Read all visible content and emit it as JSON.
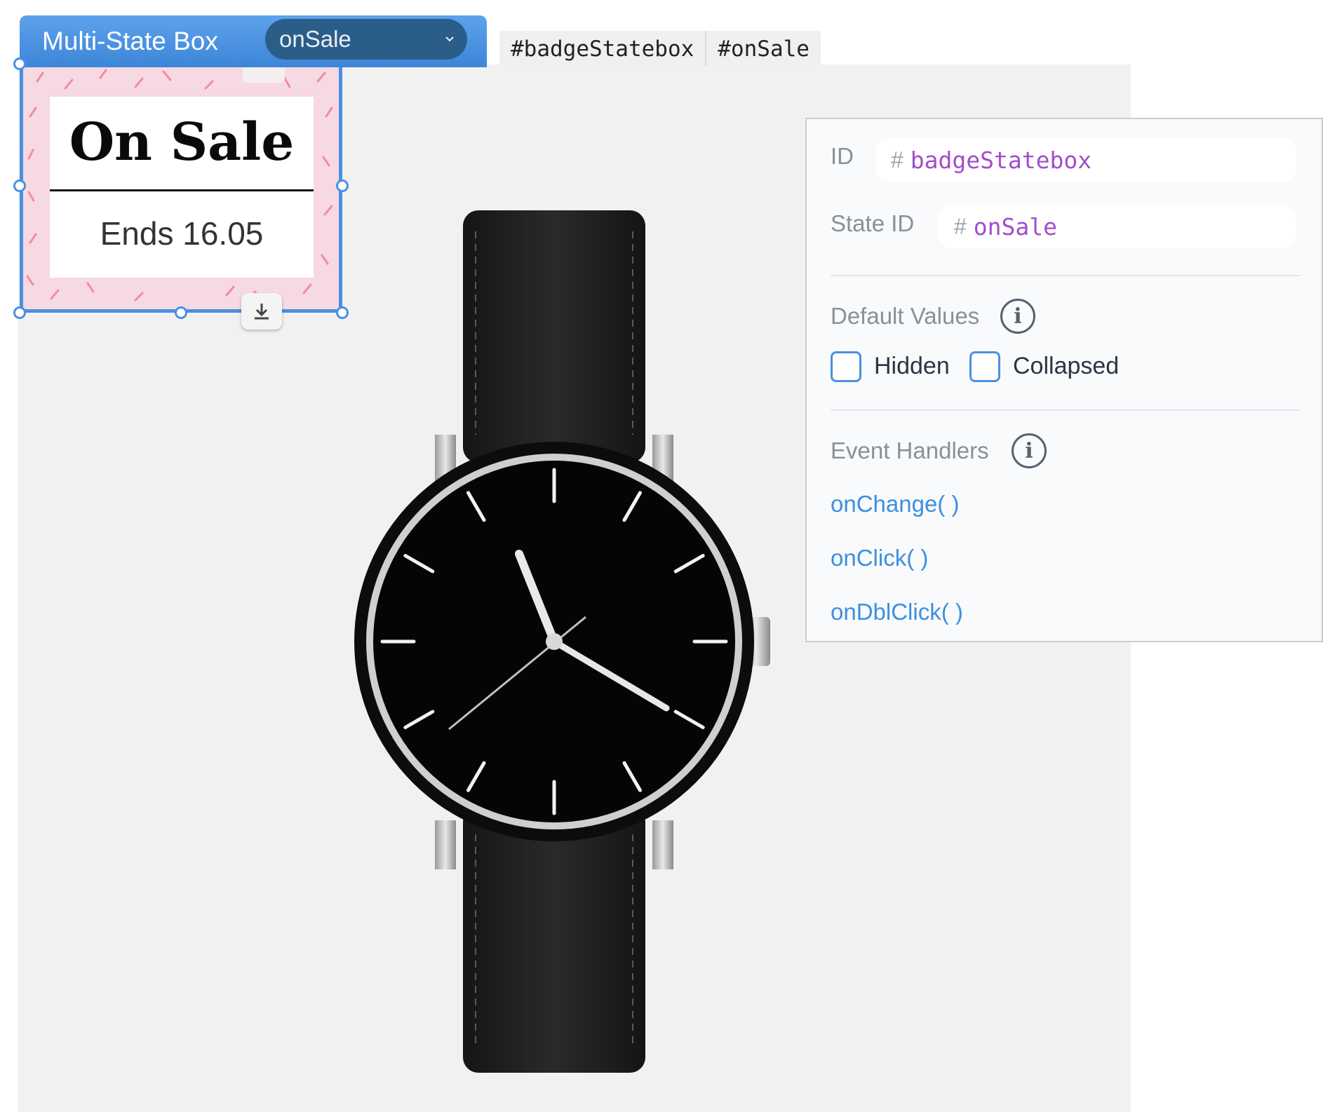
{
  "toolbar": {
    "title": "Multi-State Box",
    "state_selected": "onSale"
  },
  "id_tags": [
    "#badgeStatebox",
    "#onSale"
  ],
  "badge": {
    "title": "On Sale",
    "subtitle": "Ends 16.05"
  },
  "properties": {
    "id_label": "ID",
    "id_value": "badgeStatebox",
    "state_id_label": "State ID",
    "state_id_value": "onSale",
    "hash": "#",
    "default_values_label": "Default Values",
    "hidden_label": "Hidden",
    "collapsed_label": "Collapsed",
    "event_handlers_label": "Event Handlers",
    "handlers": [
      "onChange( )",
      "onClick( )",
      "onDblClick( )"
    ]
  },
  "colors": {
    "selection_blue": "#4a90e2",
    "badge_pink": "#f7d9e3",
    "id_purple": "#a34dcb",
    "link_blue": "#3d8fe0"
  }
}
